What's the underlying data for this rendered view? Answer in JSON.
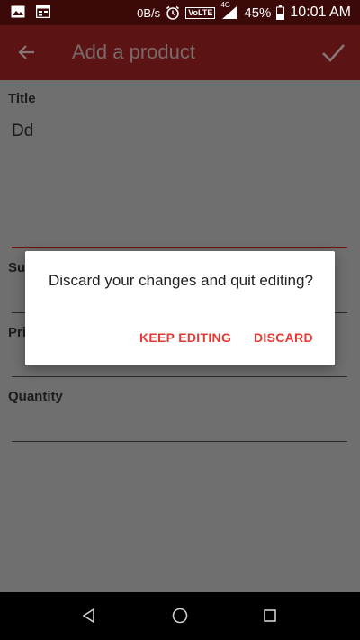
{
  "status_bar": {
    "left_icons": [
      "image-icon",
      "calendar-icon"
    ],
    "speed": "0B/s",
    "volte": "VoLTE",
    "network": "4G",
    "battery_percent": "45%",
    "time": "10:01 AM"
  },
  "app_bar": {
    "title": "Add a product",
    "back_icon": "arrow-left-icon",
    "save_icon": "check-icon"
  },
  "form": {
    "title_label": "Title",
    "title_value": "Dd",
    "supplier_label_partial": "Su",
    "price_label_partial": "Pri",
    "quantity_label": "Quantity"
  },
  "dialog": {
    "message": "Discard your changes and quit editing?",
    "keep_editing": "KEEP EDITING",
    "discard": "DISCARD"
  },
  "nav_bar": {
    "buttons": [
      "back-triangle-icon",
      "home-circle-icon",
      "recents-square-icon"
    ]
  }
}
